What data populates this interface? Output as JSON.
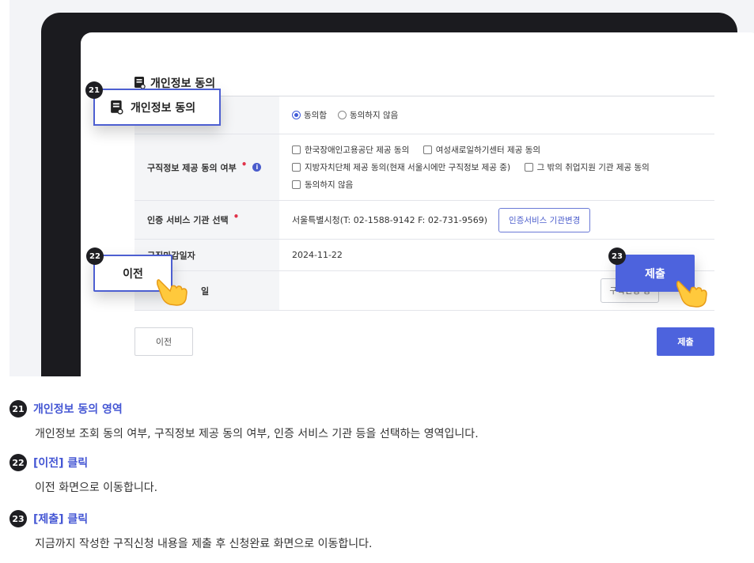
{
  "section": {
    "title": "개인정보 동의"
  },
  "form": {
    "rows": [
      {
        "label": "",
        "radio_agree": "동의함",
        "radio_disagree": "동의하지 않음"
      },
      {
        "label": "구직정보 제공 동의 여부",
        "info": "i",
        "options_line1": [
          "한국장애인고용공단 제공 동의",
          "여성새로일하기센터 제공 동의"
        ],
        "options_line2": [
          "지방자치단체 제공 동의(현재 서울시에만 구직정보 제공 중)",
          "그 밖의 취업지원 기관 제공 동의"
        ],
        "options_line3": [
          "동의하지 않음"
        ]
      },
      {
        "label": "인증 서비스 기관 선택",
        "value": "서울특별시청(T: 02-1588-9142 F: 02-731-9569)",
        "button": "인증서비스 기관변경"
      },
      {
        "label": "구직마감일자",
        "value": "2024-11-22"
      },
      {
        "label_fragment": "일",
        "button": "구직신청 정"
      }
    ],
    "prev_label": "이전",
    "submit_label": "제출"
  },
  "callouts": [
    {
      "number": "21",
      "label": "개인정보 동의"
    },
    {
      "number": "22",
      "label": "이전"
    },
    {
      "number": "23",
      "label": "제출"
    }
  ],
  "descriptions": [
    {
      "number": "21",
      "title": "개인정보 동의 영역",
      "body": "개인정보 조회 동의 여부, 구직정보 제공 동의 여부, 인증 서비스 기관 등을 선택하는 영역입니다."
    },
    {
      "number": "22",
      "title": "[이전] 클릭",
      "body": "이전 화면으로 이동합니다."
    },
    {
      "number": "23",
      "title": "[제출] 클릭",
      "body": "지금까지 작성한 구직신청 내용을 제출 후 신청완료 화면으로 이동합니다."
    }
  ],
  "colors": {
    "accent": "#4d63dd",
    "required": "#e0334a",
    "badge": "#1e1e22"
  },
  "icons": [
    "document-icon",
    "pointing-hand-icon",
    "info-icon"
  ]
}
